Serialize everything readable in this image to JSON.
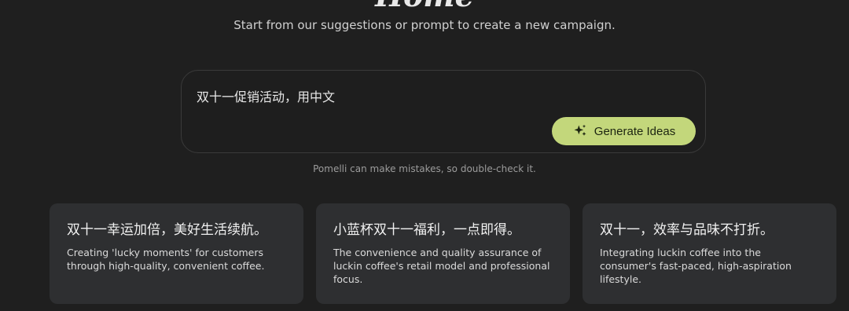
{
  "page": {
    "title": "Home",
    "subtitle": "Start from our suggestions or prompt to create a new campaign."
  },
  "prompt": {
    "value": "双十一促销活动，用中文",
    "generate_label": "Generate Ideas"
  },
  "disclaimer": "Pomelli can make mistakes, so double-check it.",
  "suggestions": [
    {
      "title": "双十一幸运加倍，美好生活续航。",
      "description": "Creating 'lucky moments' for customers through high-quality, convenient coffee."
    },
    {
      "title": "小蓝杯双十一福利，一点即得。",
      "description": "The convenience and quality assurance of luckin coffee's retail model and professional focus."
    },
    {
      "title": "双十一，效率与品味不打折。",
      "description": "Integrating luckin coffee into the consumer's fast-paced, high-aspiration lifestyle."
    }
  ],
  "colors": {
    "background": "#1f1f1f",
    "accent": "#c3d77b",
    "card": "#2e2f31"
  }
}
